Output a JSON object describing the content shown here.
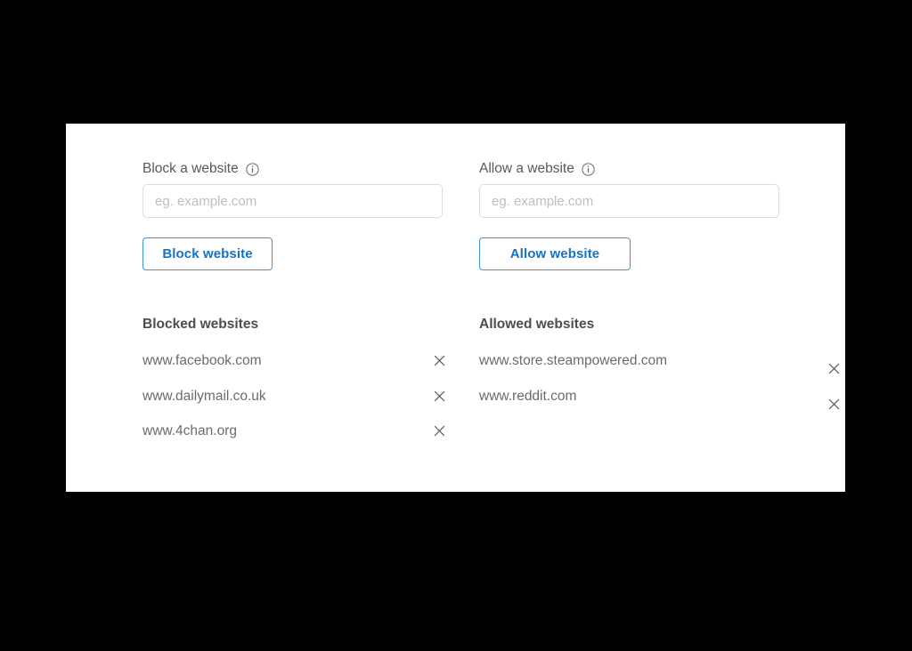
{
  "theme": {
    "card_background": "#ffffff",
    "page_background": "#000000",
    "accent_blue": "#1573c6",
    "button_border_blue": "#3b95d6",
    "label_gray": "#58595b",
    "heading_gray": "#4c4d4f",
    "list_text_gray": "#6a6b6d",
    "input_border_gray": "#dcdddf",
    "placeholder_gray": "#bcbec0"
  },
  "block_section": {
    "label": "Block a website",
    "info_icon": "info-circle-icon",
    "input_placeholder": "eg. example.com",
    "input_value": "",
    "button_label": "Block website",
    "list_heading": "Blocked websites",
    "sites": [
      "www.facebook.com",
      "www.dailymail.co.uk",
      "www.4chan.org"
    ],
    "remove_icon": "close-icon"
  },
  "allow_section": {
    "label": "Allow a website",
    "info_icon": "info-circle-icon",
    "input_placeholder": "eg. example.com",
    "input_value": "",
    "button_label": "Allow website",
    "list_heading": "Allowed websites",
    "sites": [
      "www.store.steampowered.com",
      "www.reddit.com"
    ],
    "remove_icon": "close-icon"
  }
}
